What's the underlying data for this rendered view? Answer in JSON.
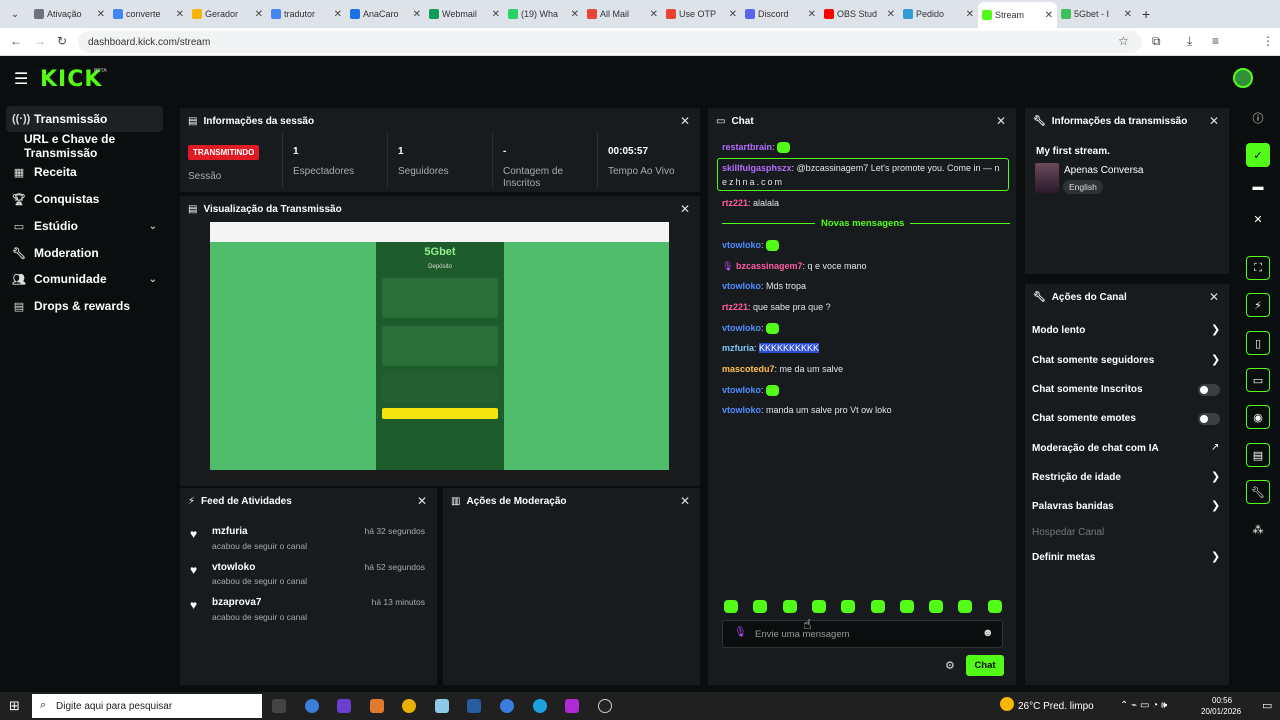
{
  "browser": {
    "tabs": [
      {
        "label": "Ativação",
        "color": "#6b7280"
      },
      {
        "label": "converte",
        "color": "#4285f4"
      },
      {
        "label": "Gerador",
        "color": "#f4b400"
      },
      {
        "label": "tradutor",
        "color": "#4285f4"
      },
      {
        "label": "AnaCaro",
        "color": "#1a73e8"
      },
      {
        "label": "Webmail",
        "color": "#0f9d58"
      },
      {
        "label": "(19) Wha",
        "color": "#25d366"
      },
      {
        "label": "All Mail",
        "color": "#ea4335"
      },
      {
        "label": "Use OTP",
        "color": "#ea4335"
      },
      {
        "label": "Discord",
        "color": "#5865f2"
      },
      {
        "label": "OBS Stud",
        "color": "#ff0000"
      },
      {
        "label": "Pedido",
        "color": "#2f9bd8"
      },
      {
        "label": "Stream",
        "color": "#53fc18",
        "active": true
      },
      {
        "label": "5Gbet - I",
        "color": "#3fbf5a"
      }
    ],
    "url": "dashboard.kick.com/stream",
    "avatar_letter": "b"
  },
  "header": {
    "logo": "KICK",
    "beta": "BETA"
  },
  "sidebar": {
    "items": [
      {
        "label": "Transmissão",
        "icon": "broadcast-icon"
      },
      {
        "label": "URL e Chave de Transmissão"
      },
      {
        "label": "Receita",
        "icon": "revenue-icon"
      },
      {
        "label": "Conquistas",
        "icon": "trophy-icon"
      },
      {
        "label": "Estúdio",
        "icon": "studio-icon"
      },
      {
        "label": "Moderation",
        "icon": "wrench-icon"
      },
      {
        "label": "Comunidade",
        "icon": "community-icon"
      },
      {
        "label": "Drops & rewards",
        "icon": "drops-icon"
      }
    ]
  },
  "session": {
    "title": "Informações da sessão",
    "status_badge": "TRANSMITINDO",
    "status_label": "Sessão",
    "viewers": "1",
    "viewers_label": "Espectadores",
    "followers": "1",
    "followers_label": "Seguidores",
    "subs": "-",
    "subs_label": "Contagem de Inscritos",
    "live_time": "00:05:57",
    "live_time_label": "Tempo Ao Vivo"
  },
  "preview": {
    "title": "Visualização da Transmissão",
    "site_logo": "5Gbet",
    "deposit": "Depósito"
  },
  "feed": {
    "title": "Feed de Atividades",
    "items": [
      {
        "user": "mzfuria",
        "action": "acabou de seguir o canal",
        "time": "há 32 segundos"
      },
      {
        "user": "vtowloko",
        "action": "acabou de seguir o canal",
        "time": "há 52 segundos"
      },
      {
        "user": "bzaprova7",
        "action": "acabou de seguir o canal",
        "time": "há 13 minutos"
      }
    ]
  },
  "moderation": {
    "title": "Ações de Moderação"
  },
  "chat": {
    "title": "Chat",
    "new_messages": "Novas mensagens",
    "messages": [
      {
        "user": "restartbrain",
        "color": "#b46cff",
        "text": "",
        "emote": true
      },
      {
        "user": "skillfulgasphszx",
        "color": "#b46cff",
        "text": "@bzcassinagem7 Let's promote you. Come in — n",
        "text2": "ezhna.com",
        "boxed": true
      },
      {
        "user": "rtz221",
        "color": "#ff5aa5",
        "text": "alalala"
      },
      {
        "user": "vtowloko",
        "color": "#4d8dff",
        "text": "",
        "emote": true
      },
      {
        "user": "bzcassinagem7",
        "color": "#ff5aa5",
        "text": "q e voce mano",
        "mic": true
      },
      {
        "user": "vtowloko",
        "color": "#4d8dff",
        "text": "Mds tropa"
      },
      {
        "user": "rtz221",
        "color": "#ff5aa5",
        "text": "que sabe pra que ?"
      },
      {
        "user": "vtowloko",
        "color": "#4d8dff",
        "text": "",
        "emote": true
      },
      {
        "user": "mzfuria",
        "color": "#7ec8ff",
        "text": "KKKKKKKKKK",
        "highlight": true
      },
      {
        "user": "mascotedu7",
        "color": "#ffc04d",
        "text": "me da um salve"
      },
      {
        "user": "vtowloko",
        "color": "#4d8dff",
        "text": "",
        "emote": true
      },
      {
        "user": "vtowloko",
        "color": "#4d8dff",
        "text": "manda um salve pro Vt ow loko"
      }
    ],
    "input_placeholder": "Envie uma mensagem",
    "send_label": "Chat"
  },
  "stream_info": {
    "title": "Informações da transmissão",
    "stream_title": "My first stream.",
    "category": "Apenas Conversa",
    "language": "English"
  },
  "channel_actions": {
    "title": "Ações do Canal",
    "items": [
      {
        "label": "Modo lento",
        "type": "chevron"
      },
      {
        "label": "Chat somente seguidores",
        "type": "chevron"
      },
      {
        "label": "Chat somente Inscritos",
        "type": "toggle"
      },
      {
        "label": "Chat somente emotes",
        "type": "toggle"
      },
      {
        "label": "Moderação de chat com IA",
        "type": "external"
      },
      {
        "label": "Restrição de idade",
        "type": "chevron"
      },
      {
        "label": "Palavras banidas",
        "type": "chevron"
      },
      {
        "label": "Hospedar Canal",
        "type": "disabled"
      },
      {
        "label": "Definir metas",
        "type": "chevron"
      }
    ]
  },
  "taskbar": {
    "search_placeholder": "Digite aqui para pesquisar",
    "weather": "26°C  Pred. limpo",
    "time": "00:56",
    "date": "20/01/2026"
  },
  "colors": {
    "accent": "#53fc18",
    "live": "#e01b24",
    "panel": "#181b1d",
    "bg": "#0b0e0f"
  }
}
